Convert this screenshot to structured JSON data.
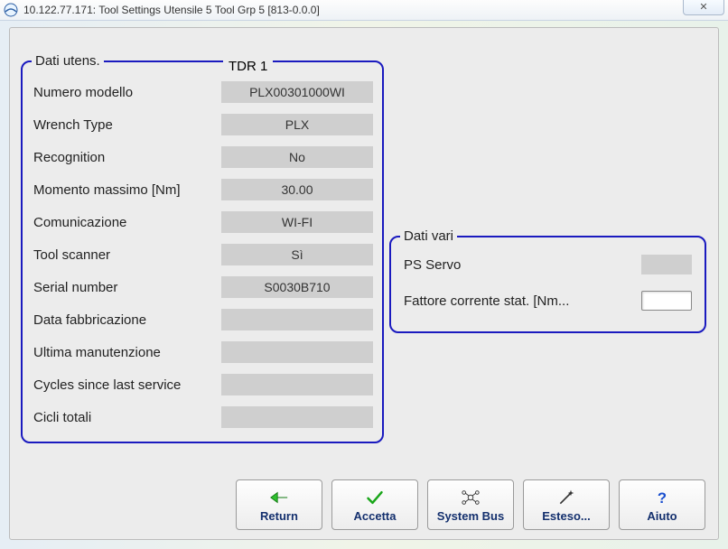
{
  "window": {
    "title": "10.122.77.171: Tool Settings  Utensile 5  Tool Grp 5 [813-0.0.0]",
    "close_glyph": "✕"
  },
  "tool_group": {
    "legend_left": "Dati utens.",
    "legend_right": "TDR 1",
    "rows": [
      {
        "label": "Numero modello",
        "value": "PLX00301000WI"
      },
      {
        "label": "Wrench Type",
        "value": "PLX"
      },
      {
        "label": "Recognition",
        "value": "No"
      },
      {
        "label": "Momento massimo  [Nm]",
        "value": "30.00"
      },
      {
        "label": "Comunicazione",
        "value": "WI-FI"
      },
      {
        "label": "Tool scanner",
        "value": "Sì"
      },
      {
        "label": "Serial number",
        "value": "S0030B710"
      },
      {
        "label": "Data fabbricazione",
        "value": ""
      },
      {
        "label": "Ultima manutenzione",
        "value": ""
      },
      {
        "label": "Cycles since last service",
        "value": ""
      },
      {
        "label": "Cicli totali",
        "value": ""
      }
    ]
  },
  "misc_group": {
    "legend": "Dati vari",
    "ps_servo_label": "PS Servo",
    "ps_servo_value": "",
    "stat_factor_label": "Fattore corrente stat. [Nm...",
    "stat_factor_value": ""
  },
  "buttons": {
    "return": "Return",
    "accept": "Accetta",
    "systembus": "System Bus",
    "extended": "Esteso...",
    "help": "Aiuto"
  }
}
